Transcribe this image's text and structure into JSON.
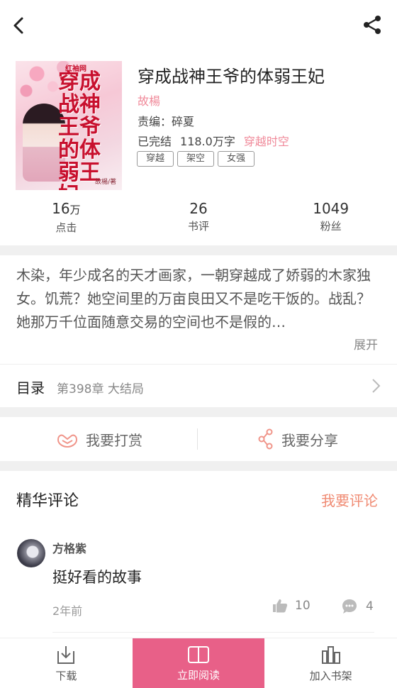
{
  "book": {
    "title": "穿成战神王爷的体弱王妃",
    "author": "故楊",
    "editor": "责编：碎夏",
    "status": "已完结",
    "word_count": "118.0万字",
    "genre": "穿越时空",
    "tags": [
      "穿越",
      "架空",
      "女强"
    ],
    "cover": {
      "brand": "红袖网",
      "title_art": "穿成战神王爷的体弱王妃",
      "author_mark": "故楊/著"
    }
  },
  "stats": [
    {
      "value": "16",
      "unit": "万",
      "label": "点击"
    },
    {
      "value": "26",
      "unit": "",
      "label": "书评"
    },
    {
      "value": "1049",
      "unit": "",
      "label": "粉丝"
    }
  ],
  "intro": {
    "text": "木染，年少成名的天才画家，一朝穿越成了娇弱的木家独女。饥荒？她空间里的万亩良田又不是吃干饭的。战乱？她那万千位面随意交易的空间也不是假的…",
    "expand_label": "展开"
  },
  "toc": {
    "label": "目录",
    "chapter": "第398章 大结局"
  },
  "actions": {
    "reward_label": "我要打赏",
    "share_label": "我要分享"
  },
  "comments_section": {
    "heading": "精华评论",
    "write_label": "我要评论",
    "items": [
      {
        "user": "方格紫",
        "text": "挺好看的故事",
        "time": "2年前",
        "likes": "10",
        "replies": "4"
      }
    ]
  },
  "bottom_bar": {
    "download_label": "下载",
    "read_label": "立即阅读",
    "shelf_label": "加入书架"
  },
  "colors": {
    "accent": "#e86088",
    "author": "#f08a9a",
    "write": "#f08a72"
  }
}
